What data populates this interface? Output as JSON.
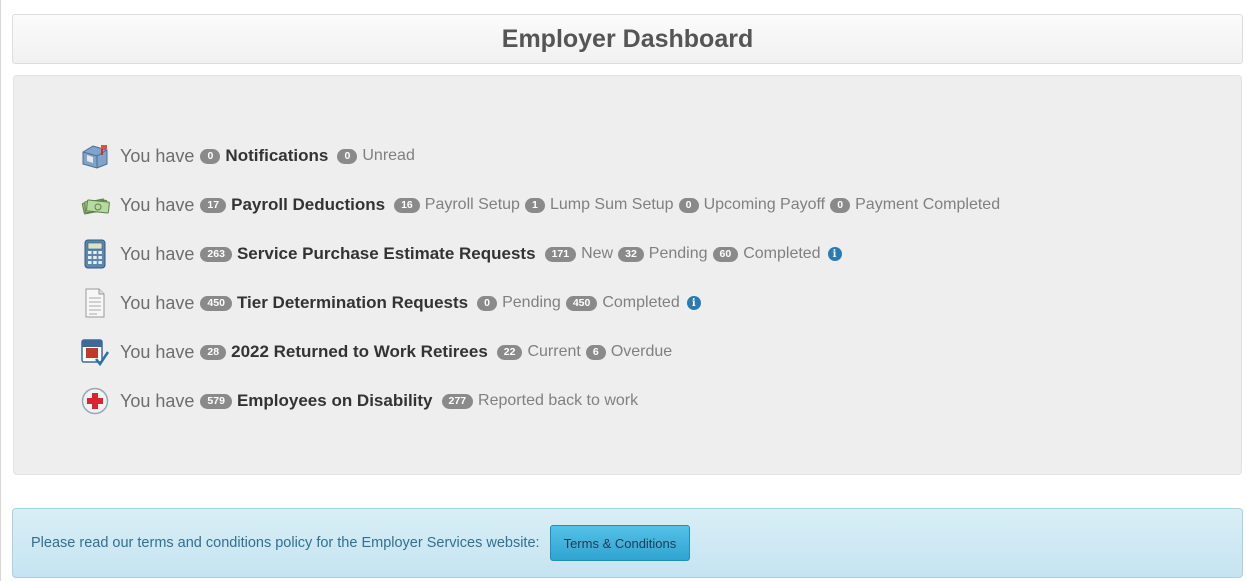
{
  "header": {
    "title": "Employer Dashboard"
  },
  "dashboard": {
    "rows": [
      {
        "icon": "mailbox-icon",
        "intro": "You have",
        "count": "0",
        "title": "Notifications",
        "details": [
          {
            "count": "0",
            "label": "Unread"
          }
        ]
      },
      {
        "icon": "money-icon",
        "intro": "You have",
        "count": "17",
        "title": "Payroll Deductions",
        "details": [
          {
            "count": "16",
            "label": "Payroll Setup"
          },
          {
            "count": "1",
            "label": "Lump Sum Setup"
          },
          {
            "count": "0",
            "label": "Upcoming Payoff"
          },
          {
            "count": "0",
            "label": "Payment Completed"
          }
        ]
      },
      {
        "icon": "calculator-icon",
        "intro": "You have",
        "count": "263",
        "title": "Service Purchase Estimate Requests",
        "details": [
          {
            "count": "171",
            "label": "New"
          },
          {
            "count": "32",
            "label": "Pending"
          },
          {
            "count": "60",
            "label": "Completed"
          }
        ],
        "info": "i"
      },
      {
        "icon": "document-icon",
        "intro": "You have",
        "count": "450",
        "title": "Tier Determination Requests",
        "details": [
          {
            "count": "0",
            "label": "Pending"
          },
          {
            "count": "450",
            "label": "Completed"
          }
        ],
        "info": "i"
      },
      {
        "icon": "calendar-check-icon",
        "intro": "You have",
        "count": "28",
        "title": "2022 Returned to Work Retirees",
        "details": [
          {
            "count": "22",
            "label": "Current"
          },
          {
            "count": "6",
            "label": "Overdue"
          }
        ]
      },
      {
        "icon": "medical-cross-icon",
        "intro": "You have",
        "count": "579",
        "title": "Employees on Disability",
        "details": [
          {
            "count": "277",
            "label": "Reported back to work"
          }
        ]
      }
    ]
  },
  "terms": {
    "text": "Please read our terms and conditions policy for the Employer Services website:",
    "button_label": "Terms & Conditions"
  },
  "colors": {
    "badge": "#8a8a8a",
    "info": "#2a7bb2",
    "terms_bg": "#d9eef6",
    "button": "#3bb0dc"
  }
}
